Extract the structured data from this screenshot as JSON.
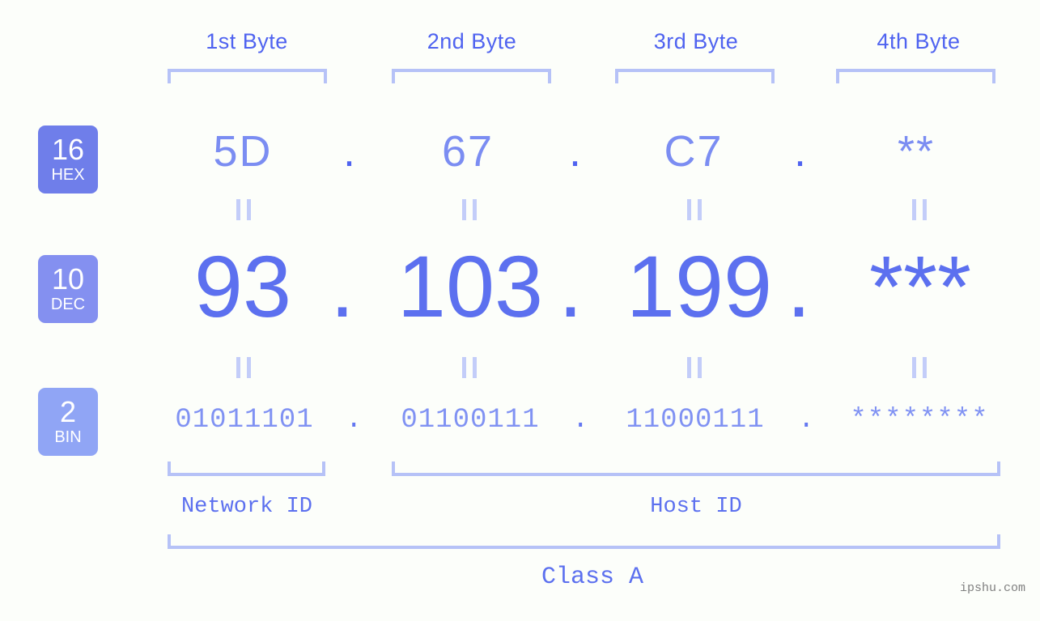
{
  "page": {
    "background_color": "#fcfefa",
    "accent_color": "#5c70ef",
    "light_accent_color": "#b6c2f7",
    "watermark": "ipshu.com"
  },
  "byte_headers": [
    {
      "label": "1st Byte"
    },
    {
      "label": "2nd Byte"
    },
    {
      "label": "3rd Byte"
    },
    {
      "label": "4th Byte"
    }
  ],
  "rows": {
    "hex": {
      "badge_number": "16",
      "badge_label": "HEX",
      "badge_color": "#6f7eea",
      "values": [
        "5D",
        "67",
        "C7",
        "**"
      ],
      "separator": "."
    },
    "dec": {
      "badge_number": "10",
      "badge_label": "DEC",
      "badge_color": "#8490f0",
      "values": [
        "93",
        "103",
        "199",
        "***"
      ],
      "separator": "."
    },
    "bin": {
      "badge_number": "2",
      "badge_label": "BIN",
      "badge_color": "#90a5f5",
      "values": [
        "01011101",
        "01100111",
        "11000111",
        "********"
      ],
      "separator": "."
    }
  },
  "id_sections": [
    {
      "label": "Network ID"
    },
    {
      "label": "Host ID"
    }
  ],
  "class_label": "Class A"
}
